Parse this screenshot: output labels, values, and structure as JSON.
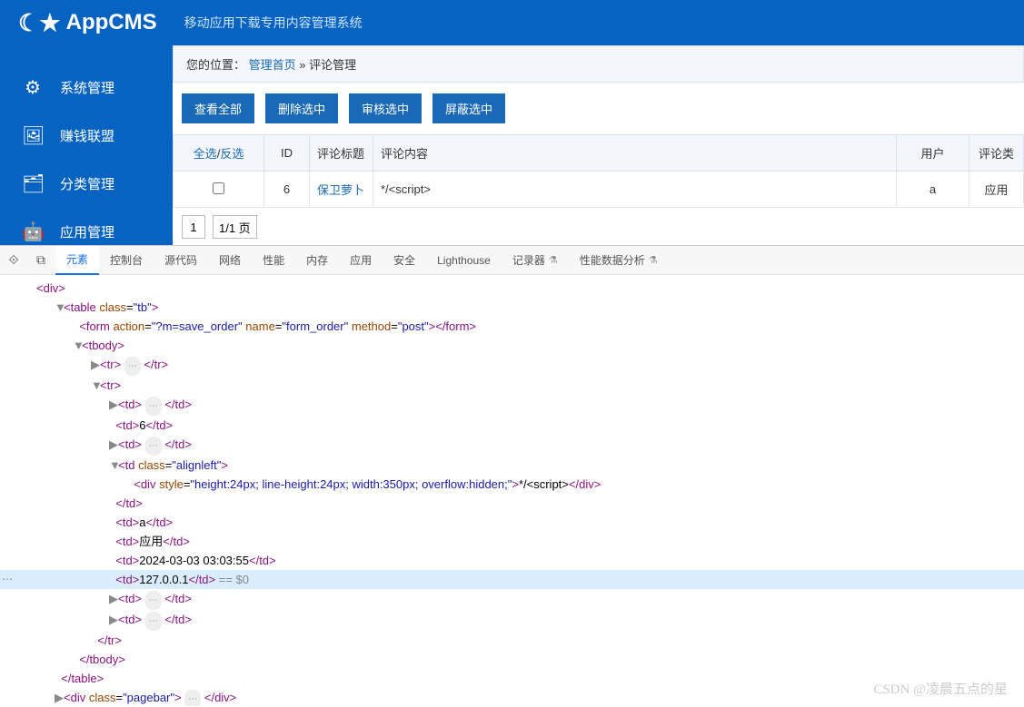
{
  "header": {
    "logo_text": "AppCMS",
    "subtitle": "移动应用下载专用内容管理系统"
  },
  "sidebar": {
    "items": [
      {
        "icon": "⚙",
        "label": "系统管理"
      },
      {
        "icon": "🖼",
        "label": "赚钱联盟"
      },
      {
        "icon": "🗂",
        "label": "分类管理"
      },
      {
        "icon": "🤖",
        "label": "应用管理"
      }
    ]
  },
  "breadcrumb": {
    "prefix": "您的位置：",
    "home": "管理首页",
    "sep": " » ",
    "current": "评论管理"
  },
  "toolbar": {
    "btns": [
      "查看全部",
      "删除选中",
      "审核选中",
      "屏蔽选中"
    ]
  },
  "table": {
    "headers": {
      "sel_all": "全选",
      "sel_sep": "/",
      "sel_inv": "反选",
      "id": "ID",
      "title": "评论标题",
      "content": "评论内容",
      "user": "用户",
      "type": "评论类"
    },
    "row": {
      "id": "6",
      "title": "保卫萝卜",
      "content": "*/<script>",
      "user": "a",
      "type": "应用"
    }
  },
  "pager": {
    "page": "1",
    "total": "1/1 页"
  },
  "devtools": {
    "tabs": [
      "元素",
      "控制台",
      "源代码",
      "网络",
      "性能",
      "内存",
      "应用",
      "安全",
      "Lighthouse",
      "记录器",
      "性能数据分析"
    ],
    "active_tab": "元素",
    "beta_icon": "⚗",
    "dom": {
      "l0": "<div>",
      "l1_open": "<table",
      "l1_attr": "class",
      "l1_val": "\"tb\"",
      "l1_close": ">",
      "l2_open": "<form",
      "l2_a1": "action",
      "l2_v1": "\"?m=save_order\"",
      "l2_a2": "name",
      "l2_v2": "\"form_order\"",
      "l2_a3": "method",
      "l2_v3": "\"post\"",
      "l2_close": "></form>",
      "l3": "<tbody>",
      "l4_a": "<tr>",
      "l4_b": "</tr>",
      "l5": "<tr>",
      "l6_a": "<td>",
      "l6_b": "</td>",
      "l7_a": "<td>",
      "l7_t": "6",
      "l7_b": "</td>",
      "l8_a": "<td>",
      "l8_b": "</td>",
      "l9_open": "<td",
      "l9_attr": "class",
      "l9_val": "\"alignleft\"",
      "l9_close": ">",
      "l10_open": "<div",
      "l10_attr": "style",
      "l10_val": "\"height:24px; line-height:24px; width:350px; overflow:hidden;\"",
      "l10_close": ">",
      "l10_t": "*/<script>",
      "l10_end": "</div>",
      "l11": "</td>",
      "l12_a": "<td>",
      "l12_t": "a",
      "l12_b": "</td>",
      "l13_a": "<td>",
      "l13_t": "应用",
      "l13_b": "</td>",
      "l14_a": "<td>",
      "l14_t": "2024-03-03 03:03:55",
      "l14_b": "</td>",
      "l15_a": "<td>",
      "l15_t": "127.0.0.1",
      "l15_b": "</td>",
      "l15_sel": " == $0",
      "l16_a": "<td>",
      "l16_b": "</td>",
      "l17_a": "<td>",
      "l17_b": "</td>",
      "l18": "</tr>",
      "l19": "</tbody>",
      "l20": "</table>",
      "l21_open": "<div",
      "l21_attr": "class",
      "l21_val": "\"pagebar\"",
      "l21_close": ">",
      "l21_end": "</div>"
    }
  },
  "watermark": "CSDN @凌晨五点的星"
}
